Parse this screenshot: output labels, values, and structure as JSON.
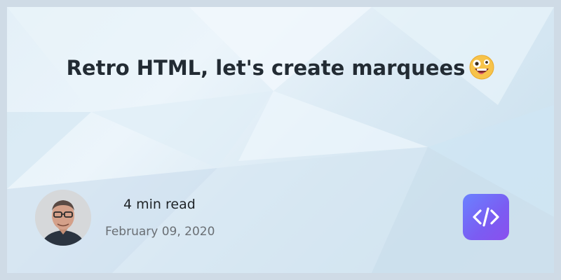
{
  "card": {
    "title": "Retro HTML, let's create marquees",
    "title_emoji": "zany-face-emoji",
    "read_time": "4 min read",
    "date": "February 09, 2020"
  },
  "author": {
    "avatar": "author-avatar"
  },
  "brand": {
    "logo_icon": "code-brackets-icon",
    "accent": "#7567f5"
  },
  "colors": {
    "background": "#dde9f3",
    "title": "#222b33",
    "date": "#6a6f74"
  }
}
